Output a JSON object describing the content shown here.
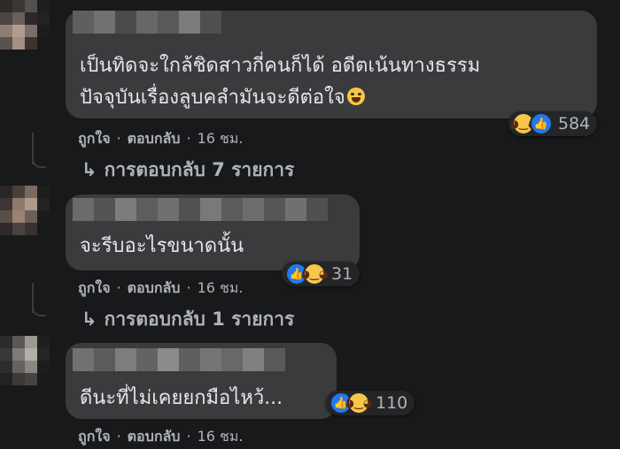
{
  "comments": [
    {
      "text_lines": [
        "เป็นทิดจะใกล้ชิดสาวกี่คนก็ได้ อดีตเน้นทางธรรม",
        "ปัจจุบันเรื่องลูบคลำมันจะดีต่อใจ"
      ],
      "trailing_emoji": "grinning-squint-icon",
      "reaction_icons": [
        "haha-icon",
        "like-icon"
      ],
      "reaction_count": "584",
      "like_label": "ถูกใจ",
      "reply_label": "ตอบกลับ",
      "time": "16 ชม.",
      "replies_label": "การตอบกลับ 7 รายการ"
    },
    {
      "text_lines": [
        "จะรีบอะไรขนาดนั้น"
      ],
      "reaction_icons": [
        "like-icon",
        "haha-icon"
      ],
      "reaction_count": "31",
      "like_label": "ถูกใจ",
      "reply_label": "ตอบกลับ",
      "time": "16 ชม.",
      "replies_label": "การตอบกลับ 1 รายการ"
    },
    {
      "text_lines": [
        "ดีนะที่ไม่เคยยกมือไหว้..."
      ],
      "reaction_icons": [
        "like-icon",
        "haha-icon"
      ],
      "reaction_count": "110",
      "like_label": "ถูกใจ",
      "reply_label": "ตอบกลับ",
      "time": "16 ชม."
    }
  ],
  "separator": "·",
  "reply_arrow": "↳",
  "colors": {
    "background": "#18191a",
    "bubble": "#3a3b3c",
    "text": "#e4e6eb",
    "muted": "#b0b3b8",
    "like_blue": "#2078f4",
    "haha_yellow": "#f7c64a"
  }
}
